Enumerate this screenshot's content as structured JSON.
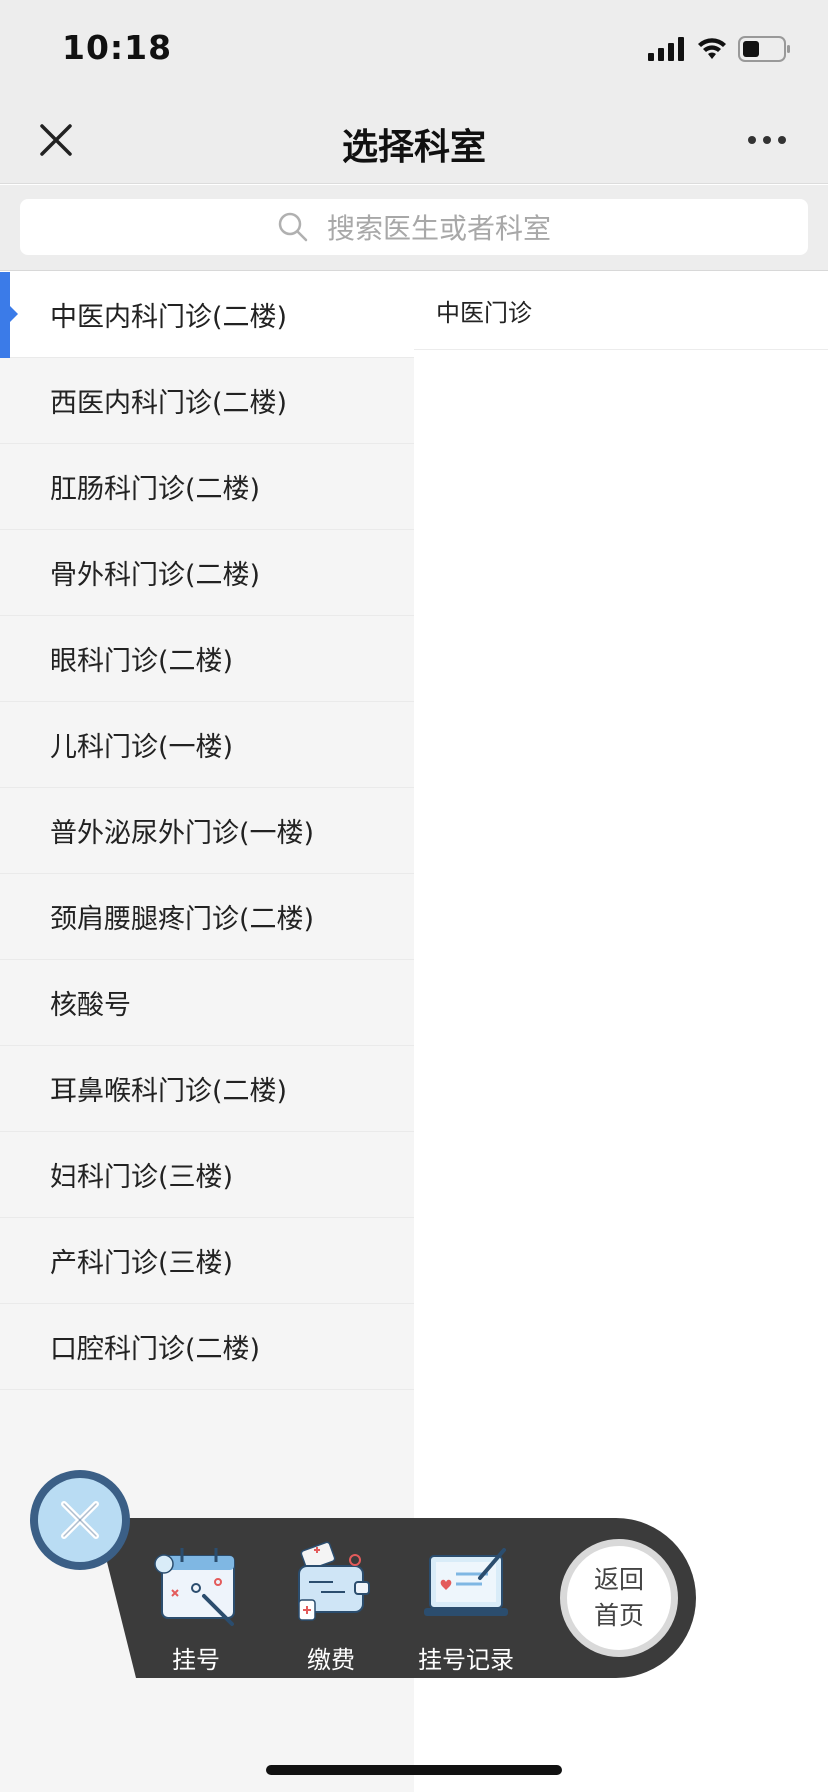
{
  "status_bar": {
    "time": "10:18"
  },
  "nav": {
    "title": "选择科室"
  },
  "search": {
    "placeholder": "搜索医生或者科室"
  },
  "departments": [
    {
      "label": "中医内科门诊(二楼)",
      "active": true
    },
    {
      "label": "西医内科门诊(二楼)"
    },
    {
      "label": "肛肠科门诊(二楼)"
    },
    {
      "label": "骨外科门诊(二楼)"
    },
    {
      "label": "眼科门诊(二楼)"
    },
    {
      "label": "儿科门诊(一楼)"
    },
    {
      "label": "普外泌尿外门诊(一楼)"
    },
    {
      "label": "颈肩腰腿疼门诊(二楼)"
    },
    {
      "label": "核酸号"
    },
    {
      "label": "耳鼻喉科门诊(二楼)"
    },
    {
      "label": "妇科门诊(三楼)"
    },
    {
      "label": "产科门诊(三楼)"
    },
    {
      "label": "口腔科门诊(二楼)"
    }
  ],
  "sub_departments": [
    {
      "label": "中医门诊"
    }
  ],
  "float_bar": {
    "register_label": "挂号",
    "payment_label": "缴费",
    "records_label": "挂号记录",
    "home_line1": "返回",
    "home_line2": "首页"
  },
  "colors": {
    "accent": "#3b7be8",
    "bar_bg": "#3b3b3b",
    "fab_ring": "#3b5f86",
    "fab_fill": "#b9dcf3"
  }
}
